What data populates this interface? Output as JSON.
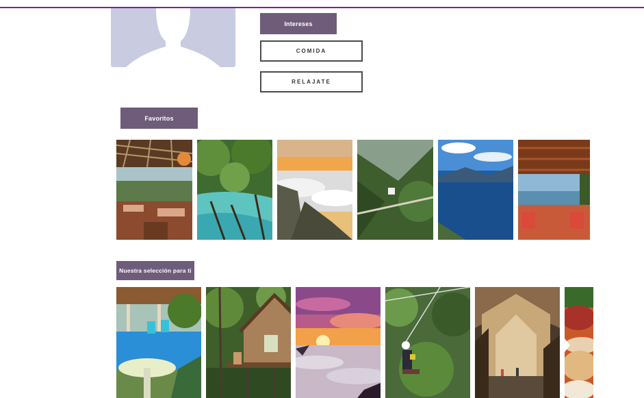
{
  "profile": {
    "avatar_icon": "person-silhouette-icon"
  },
  "interests": {
    "header": "Intereses",
    "items": [
      "COMIDA",
      "RELAJATE"
    ]
  },
  "favorites": {
    "header": "Favoritos",
    "images": [
      "restaurant-terrace",
      "turquoise-river-pools",
      "sea-of-clouds-sunset",
      "canopy-zipline-forest",
      "lake-volcano-view",
      "lake-view-terrace"
    ]
  },
  "selection": {
    "header": "Nuestra selección para ti",
    "images": [
      "pool-resort",
      "jungle-cabin",
      "pink-sunset-clouds",
      "zipline-rider",
      "cave-interior",
      "food-platter"
    ]
  },
  "colors": {
    "accent_line": "#8a1a8c",
    "tag_bg": "#6f5c7a",
    "avatar_bg": "#c9cbe0"
  }
}
